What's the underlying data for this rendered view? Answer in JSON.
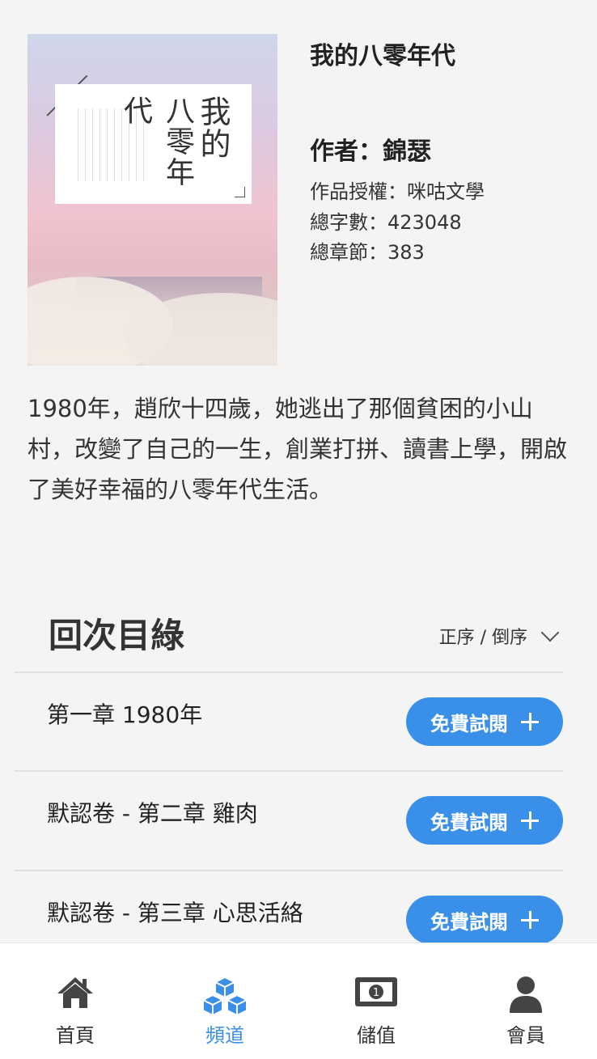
{
  "book": {
    "title": "我的八零年代",
    "author": "作者：錦瑟",
    "license": "作品授權：咪咕文學",
    "word_count": "總字數：423048",
    "chapter_count": "總章節：383",
    "cover_title_line1": "我的",
    "cover_title_line2": "八零年代",
    "description": "1980年，趙欣十四歲，她逃出了那個貧困的小山村，改變了自己的一生，創業打拼、讀書上學，開啟了美好幸福的八零年代生活。"
  },
  "toc": {
    "heading": "回次目綠",
    "sort_label": "正序 / 倒序",
    "chapters": [
      {
        "title": "第一章 1980年",
        "button": "免費試閱"
      },
      {
        "title": "默認卷 - 第二章 雞肉",
        "button": "免費試閱"
      },
      {
        "title": "默認卷 - 第三章 心思活絡",
        "button": "免費試閱"
      }
    ]
  },
  "tabbar": {
    "home": {
      "label": "首頁",
      "icon": "home-icon"
    },
    "channel": {
      "label": "頻道",
      "icon": "cubes-icon"
    },
    "topup": {
      "label": "儲值",
      "icon": "money-icon"
    },
    "member": {
      "label": "會員",
      "icon": "user-icon"
    }
  },
  "colors": {
    "accent": "#3a8fe8",
    "background": "#f4f4f4"
  }
}
